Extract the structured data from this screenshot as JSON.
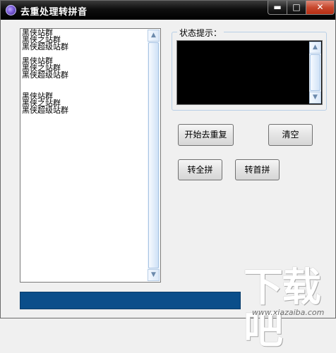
{
  "window": {
    "title": "去重处理转拼音",
    "controls": {
      "minimize": "▬",
      "maximize": "□",
      "close": "✕"
    }
  },
  "input_text": {
    "content": "黑侠站群\n黑侠之站群\n黑侠超级站群\n\n黑侠站群\n黑侠之站群\n黑侠超级站群\n\n\n黑侠站群\n黑侠之站群\n黑侠超级站群"
  },
  "status": {
    "label": "状态提示：",
    "text": ""
  },
  "buttons": {
    "dedupe": "开始去重复",
    "clear": "清空",
    "full_pinyin": "转全拼",
    "initial_pinyin": "转首拼"
  },
  "progress": {
    "value": 1.0,
    "color": "#0b4e8a"
  },
  "watermark": {
    "brand": "下载吧",
    "url": "www.xiazaiba.com"
  },
  "colors": {
    "titlebar": "#000000",
    "status_bg": "#000000",
    "progress": "#0b4e8a"
  }
}
